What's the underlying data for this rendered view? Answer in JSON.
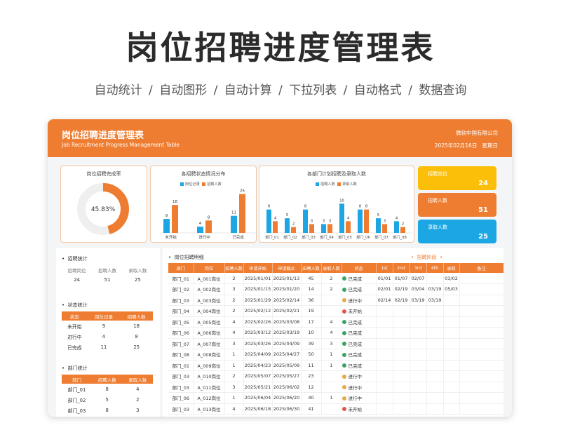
{
  "hero": {
    "title": "岗位招聘进度管理表",
    "subtitle": "自动统计   /  自动图形   /  自动计算    /  下拉列表   /  自动格式   /  数据查询"
  },
  "header": {
    "title": "岗位招聘进度管理表",
    "title_en": "Job Recruitment Progress Management Table",
    "company": "微软中国有限公司",
    "date": "2025年02月16日",
    "weekday": "星期日"
  },
  "colors": {
    "accent": "#ee7d31",
    "blue": "#1ca7e4",
    "yellow": "#fbbf0a",
    "orange": "#ee7d31",
    "done": "#3fa265",
    "progress": "#e8a84c",
    "pending": "#e4554c"
  },
  "donut": {
    "title": "岗位招聘完成率",
    "value_label": "45.83%",
    "fraction": 0.4583
  },
  "status_chart": {
    "title": "各招聘状态情况分布",
    "legend": [
      "岗位记录",
      "招聘人数"
    ],
    "categories": [
      "未开始",
      "进行中",
      "已完成"
    ],
    "jobs": [
      9,
      4,
      11
    ],
    "people": [
      18,
      8,
      25
    ],
    "max": 28
  },
  "dept_chart": {
    "title": "各部门计划招聘及录取人数",
    "legend": [
      "招聘人数",
      "录取人数"
    ],
    "categories": [
      "部门_01",
      "部门_02",
      "部门_03",
      "部门_04",
      "部门_05",
      "部门_06",
      "部门_07",
      "部门_08"
    ],
    "recruit": [
      8,
      5,
      8,
      3,
      10,
      8,
      5,
      4
    ],
    "hired": [
      4,
      2,
      3,
      3,
      4,
      8,
      3,
      2
    ],
    "max": 12
  },
  "kpis": [
    {
      "label": "招聘岗位",
      "value": "24"
    },
    {
      "label": "招聘人数",
      "value": "51"
    },
    {
      "label": "录取人数",
      "value": "25"
    }
  ],
  "recruit_stats": {
    "title": "招聘统计",
    "headers": [
      "招聘岗位",
      "招聘人数",
      "录取人数"
    ],
    "values": [
      "24",
      "51",
      "25"
    ]
  },
  "status_stats": {
    "title": "状态统计",
    "headers": [
      "状态",
      "岗位记录",
      "招聘人数"
    ],
    "rows": [
      [
        "未开始",
        "9",
        "18"
      ],
      [
        "进行中",
        "4",
        "8"
      ],
      [
        "已完成",
        "11",
        "25"
      ]
    ]
  },
  "dept_stats": {
    "title": "部门统计",
    "headers": [
      "部门",
      "招聘人数",
      "录取人数"
    ],
    "rows": [
      [
        "部门_01",
        "8",
        "4"
      ],
      [
        "部门_02",
        "5",
        "2"
      ],
      [
        "部门_03",
        "8",
        "3"
      ]
    ]
  },
  "detail": {
    "title": "岗位招聘明细",
    "stage_label": "招聘阶段",
    "headers": [
      "部门",
      "岗位",
      "招聘人数",
      "申请开始",
      "申请截止",
      "应聘人数",
      "录取人数",
      "状态",
      "1st",
      "2nd",
      "3rd",
      "4th",
      "录取",
      "备注"
    ],
    "rows": [
      [
        "部门_01",
        "A_001岗位",
        "2",
        "2025/01/01",
        "2025/01/13",
        "45",
        "2",
        "已完成",
        "01/01",
        "01/07",
        "02/07",
        "",
        "03/02",
        ""
      ],
      [
        "部门_02",
        "A_002岗位",
        "3",
        "2025/01/15",
        "2025/01/20",
        "14",
        "2",
        "已完成",
        "02/01",
        "02/19",
        "03/04",
        "03/19",
        "05/03",
        ""
      ],
      [
        "部门_03",
        "A_003岗位",
        "2",
        "2025/01/29",
        "2025/02/14",
        "36",
        "",
        "进行中",
        "02/14",
        "02/19",
        "03/19",
        "03/19",
        "",
        ""
      ],
      [
        "部门_04",
        "A_004岗位",
        "2",
        "2025/02/12",
        "2025/02/21",
        "19",
        "",
        "未开始",
        "",
        "",
        "",
        "",
        "",
        ""
      ],
      [
        "部门_05",
        "A_005岗位",
        "4",
        "2025/02/26",
        "2025/03/08",
        "17",
        "4",
        "已完成",
        "",
        "",
        "",
        "",
        "",
        ""
      ],
      [
        "部门_06",
        "A_006岗位",
        "4",
        "2025/03/12",
        "2025/03/19",
        "10",
        "4",
        "已完成",
        "",
        "",
        "",
        "",
        "",
        ""
      ],
      [
        "部门_07",
        "A_007岗位",
        "3",
        "2025/03/26",
        "2025/04/09",
        "39",
        "3",
        "已完成",
        "",
        "",
        "",
        "",
        "",
        ""
      ],
      [
        "部门_08",
        "A_008岗位",
        "1",
        "2025/04/09",
        "2025/04/27",
        "50",
        "1",
        "已完成",
        "",
        "",
        "",
        "",
        "",
        ""
      ],
      [
        "部门_01",
        "A_009岗位",
        "1",
        "2025/04/23",
        "2025/05/09",
        "11",
        "1",
        "已完成",
        "",
        "",
        "",
        "",
        "",
        ""
      ],
      [
        "部门_03",
        "A_010岗位",
        "2",
        "2025/05/07",
        "2025/05/27",
        "23",
        "",
        "进行中",
        "",
        "",
        "",
        "",
        "",
        ""
      ],
      [
        "部门_03",
        "A_011岗位",
        "3",
        "2025/05/21",
        "2025/06/02",
        "12",
        "",
        "进行中",
        "",
        "",
        "",
        "",
        "",
        ""
      ],
      [
        "部门_06",
        "A_012岗位",
        "1",
        "2025/06/04",
        "2025/06/20",
        "40",
        "1",
        "进行中",
        "",
        "",
        "",
        "",
        "",
        ""
      ],
      [
        "部门_03",
        "A_013岗位",
        "4",
        "2025/06/18",
        "2025/06/30",
        "41",
        "",
        "未开始",
        "",
        "",
        "",
        "",
        "",
        ""
      ]
    ]
  }
}
